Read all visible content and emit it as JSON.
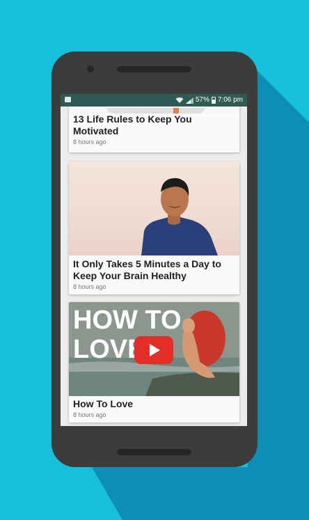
{
  "status_bar": {
    "battery": "57%",
    "time": "7:06 pm"
  },
  "feed": {
    "items": [
      {
        "title": "13 Life Rules to Keep You Motivated",
        "time": "8 hours ago"
      },
      {
        "title": "It Only Takes 5 Minutes a Day to Keep Your Brain Healthy",
        "time": "8 hours ago"
      },
      {
        "title": "How To Love",
        "time": "8 hours ago",
        "thumbnail_text_line1": "HOW TO",
        "thumbnail_text_line2": "LOVE"
      }
    ]
  },
  "colors": {
    "background": "#16bfda",
    "phone_body": "#3c3c3c",
    "status_bar": "#2e5c54",
    "youtube_red": "#e52d27"
  }
}
